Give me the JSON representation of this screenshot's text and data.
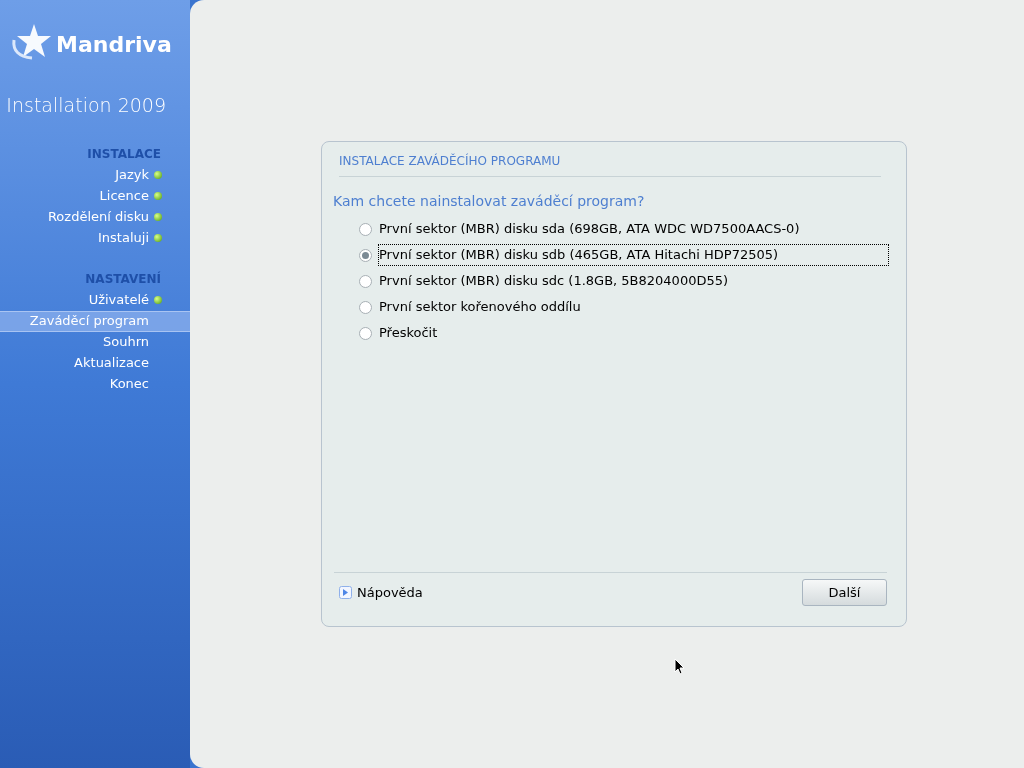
{
  "sidebar": {
    "logo": "Mandriva",
    "subtitle": "Installation 2009",
    "sections": [
      {
        "title": "INSTALACE",
        "items": [
          {
            "label": "Jazyk",
            "done": true,
            "selected": false
          },
          {
            "label": "Licence",
            "done": true,
            "selected": false
          },
          {
            "label": "Rozdělení disku",
            "done": true,
            "selected": false
          },
          {
            "label": "Instaluji",
            "done": true,
            "selected": false
          }
        ]
      },
      {
        "title": "NASTAVENÍ",
        "items": [
          {
            "label": "Uživatelé",
            "done": true,
            "selected": false
          },
          {
            "label": "Zaváděcí program",
            "done": false,
            "selected": true
          },
          {
            "label": "Souhrn",
            "done": false,
            "selected": false
          },
          {
            "label": "Aktualizace",
            "done": false,
            "selected": false
          },
          {
            "label": "Konec",
            "done": false,
            "selected": false
          }
        ]
      }
    ]
  },
  "dialog": {
    "title": "INSTALACE ZAVÁDĚCÍHO PROGRAMU",
    "question": "Kam chcete nainstalovat zaváděcí program?",
    "options": [
      {
        "label": "První sektor (MBR) disku sda (698GB, ATA WDC WD7500AACS-0)",
        "selected": false
      },
      {
        "label": "První sektor (MBR) disku sdb (465GB, ATA Hitachi HDP72505)",
        "selected": true
      },
      {
        "label": "První sektor (MBR) disku sdc (1.8GB, 5B8204000D55)",
        "selected": false
      },
      {
        "label": "První sektor kořenového oddílu",
        "selected": false
      },
      {
        "label": "Přeskočit",
        "selected": false
      }
    ],
    "help": "Nápověda",
    "next_button": "Další"
  }
}
